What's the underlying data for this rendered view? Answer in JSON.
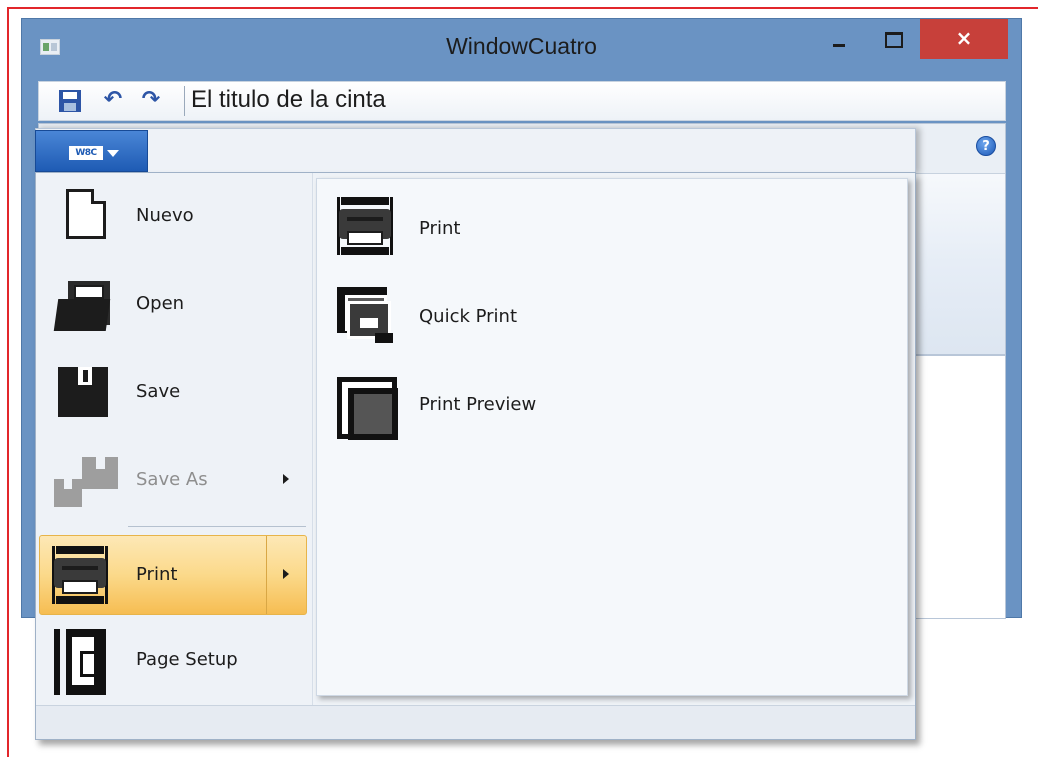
{
  "window": {
    "title": "WindowCuatro",
    "close_glyph": "×"
  },
  "quick_access": {
    "ribbon_title": "El titulo de la cinta",
    "undo_glyph": "↶",
    "redo_glyph": "↷"
  },
  "ribbon": {
    "app_menu_logo": "W8C",
    "help_glyph": "?"
  },
  "app_menu": {
    "items": [
      {
        "label": "Nuevo",
        "icon": "new-document-icon"
      },
      {
        "label": "Open",
        "icon": "open-folder-icon"
      },
      {
        "label": "Save",
        "icon": "save-icon"
      },
      {
        "label": "Save As",
        "icon": "save-as-icon",
        "disabled": true,
        "has_submenu": true
      },
      {
        "label": "Print",
        "icon": "printer-icon",
        "selected": true,
        "has_submenu": true
      },
      {
        "label": "Page Setup",
        "icon": "page-setup-icon"
      }
    ],
    "submenu": [
      {
        "label": "Print",
        "icon": "printer-icon"
      },
      {
        "label": "Quick Print",
        "icon": "quick-print-icon"
      },
      {
        "label": "Print Preview",
        "icon": "print-preview-icon"
      }
    ]
  },
  "colors": {
    "window_frame": "#6a93c3",
    "close_button": "#c7403a",
    "app_button": "#1e5bb4",
    "selection": "#fbd98a",
    "outer_border": "#e2262b"
  }
}
